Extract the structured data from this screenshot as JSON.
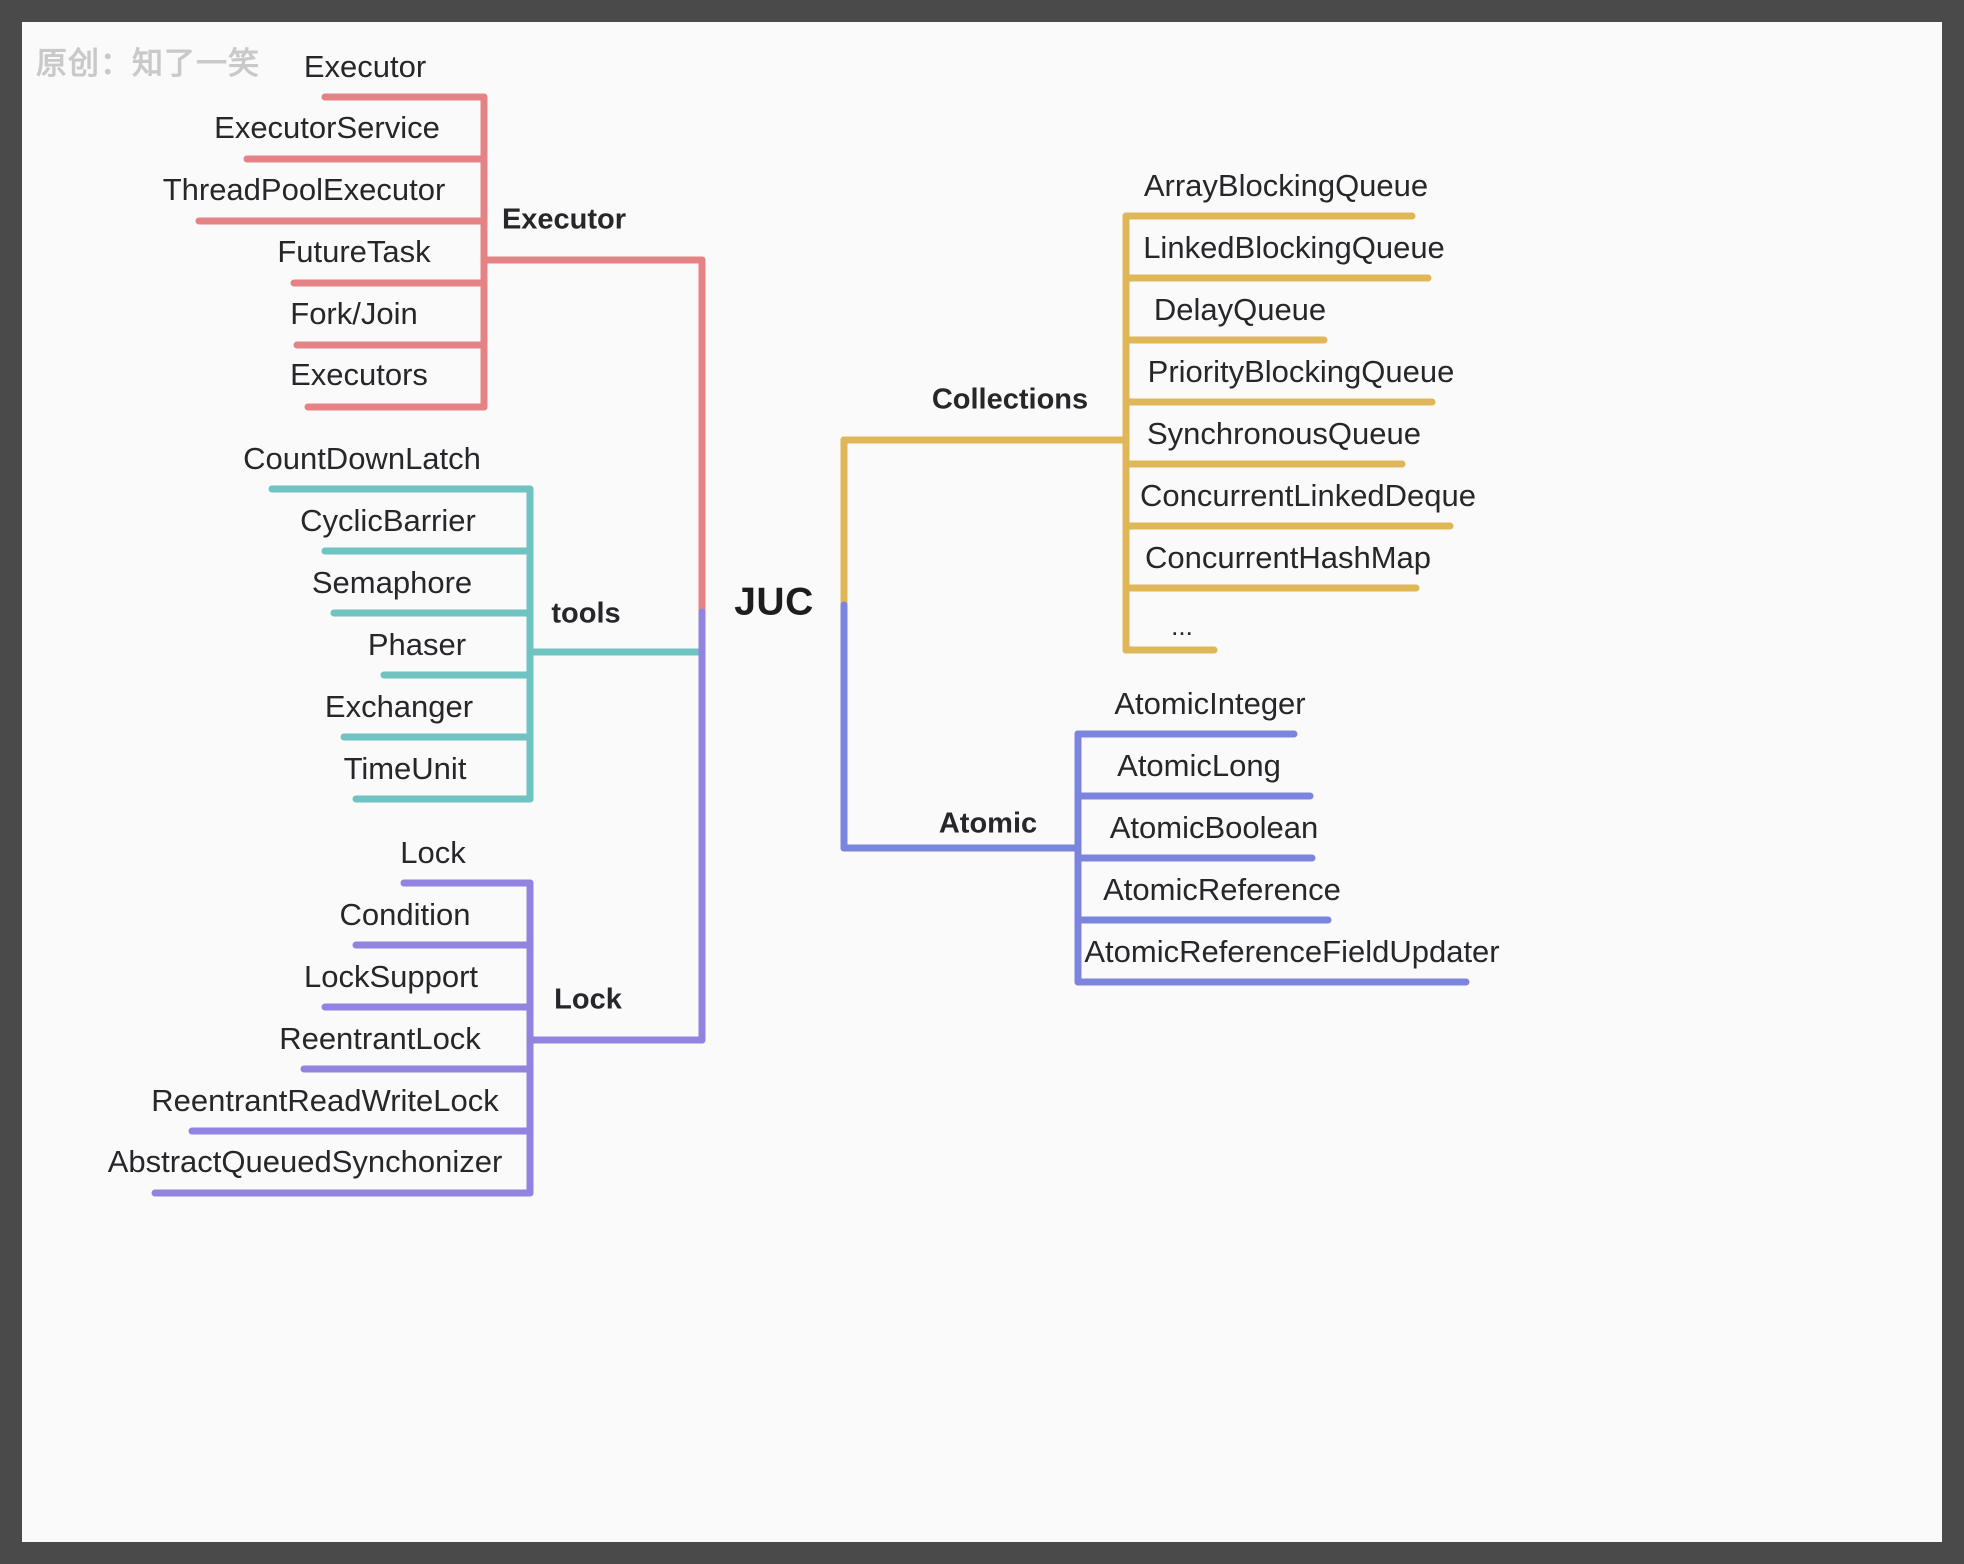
{
  "watermark": "原创：知了一笑",
  "hub": {
    "label": "JUC"
  },
  "colors": {
    "executor": "#e58285",
    "tools": "#6fc3c1",
    "lock": "#9183e0",
    "collections": "#e0b758",
    "atomic": "#7c85dd",
    "background": "#fafafa",
    "frame": "#4a4a4a",
    "text": "#27272b",
    "watermark": "#c9c9c9"
  },
  "branches": [
    {
      "id": "executor",
      "label": "Executor",
      "color": "#e58285",
      "side": "left",
      "items": [
        {
          "label": "Executor"
        },
        {
          "label": "ExecutorService"
        },
        {
          "label": "ThreadPoolExecutor"
        },
        {
          "label": "FutureTask"
        },
        {
          "label": "Fork/Join"
        },
        {
          "label": "Executors"
        }
      ]
    },
    {
      "id": "tools",
      "label": "tools",
      "color": "#6fc3c1",
      "side": "left",
      "items": [
        {
          "label": "CountDownLatch"
        },
        {
          "label": "CyclicBarrier"
        },
        {
          "label": "Semaphore"
        },
        {
          "label": "Phaser"
        },
        {
          "label": "Exchanger"
        },
        {
          "label": "TimeUnit"
        }
      ]
    },
    {
      "id": "lock",
      "label": "Lock",
      "color": "#9183e0",
      "side": "left",
      "items": [
        {
          "label": "Lock"
        },
        {
          "label": "Condition"
        },
        {
          "label": "LockSupport"
        },
        {
          "label": "ReentrantLock"
        },
        {
          "label": "ReentrantReadWriteLock"
        },
        {
          "label": "AbstractQueuedSynchonizer"
        }
      ]
    },
    {
      "id": "collections",
      "label": "Collections",
      "color": "#e0b758",
      "side": "right",
      "items": [
        {
          "label": "ArrayBlockingQueue"
        },
        {
          "label": "LinkedBlockingQueue"
        },
        {
          "label": "DelayQueue"
        },
        {
          "label": "PriorityBlockingQueue"
        },
        {
          "label": "SynchronousQueue"
        },
        {
          "label": "ConcurrentLinkedDeque"
        },
        {
          "label": "ConcurrentHashMap"
        },
        {
          "label": "..."
        }
      ]
    },
    {
      "id": "atomic",
      "label": "Atomic",
      "color": "#7c85dd",
      "side": "right",
      "items": [
        {
          "label": "AtomicInteger"
        },
        {
          "label": "AtomicLong"
        },
        {
          "label": "AtomicBoolean"
        },
        {
          "label": "AtomicReference"
        },
        {
          "label": "AtomicReferenceFieldUpdater"
        }
      ]
    }
  ]
}
